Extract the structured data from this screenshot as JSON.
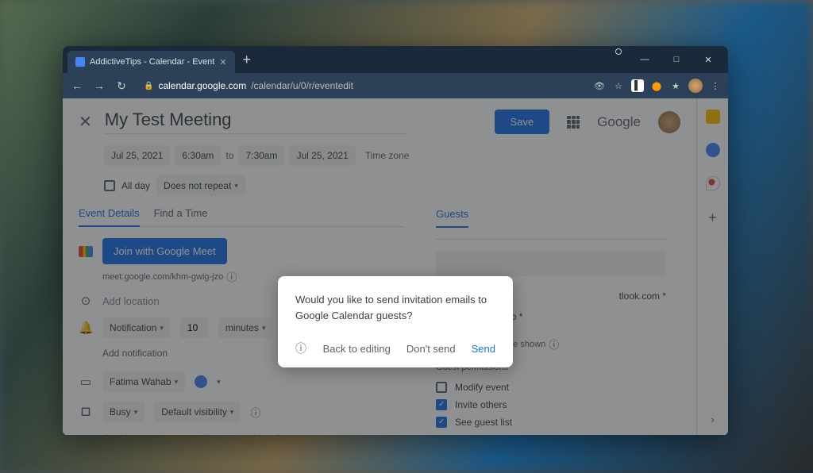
{
  "browser": {
    "tab_title": "AddictiveTips - Calendar - Event",
    "new_tab": "+",
    "url_domain": "calendar.google.com",
    "url_path": "/calendar/u/0/r/eventedit",
    "minimize": "—",
    "maximize": "□",
    "close": "✕",
    "back": "←",
    "forward": "→",
    "reload": "↻",
    "lock": "🔒",
    "eye": "👁",
    "star": "☆",
    "ext1": "▌",
    "ext2": "⬤",
    "ext3": "★",
    "menu": "⋮"
  },
  "header": {
    "close": "✕",
    "title": "My Test Meeting",
    "save": "Save",
    "google": "Google"
  },
  "datetime": {
    "start_date": "Jul 25, 2021",
    "start_time": "6:30am",
    "to": "to",
    "end_time": "7:30am",
    "end_date": "Jul 25, 2021",
    "timezone": "Time zone"
  },
  "allday": {
    "label": "All day",
    "repeat": "Does not repeat"
  },
  "tabs": {
    "details": "Event Details",
    "findtime": "Find a Time"
  },
  "meet": {
    "button": "Join with Google Meet",
    "link": "meet.google.com/khm-gwig-jzo"
  },
  "location": {
    "placeholder": "Add location"
  },
  "notification": {
    "type": "Notification",
    "value": "10",
    "unit": "minutes",
    "remove": "✕",
    "add": "Add notification"
  },
  "calendar": {
    "owner": "Fatima Wahab"
  },
  "visibility": {
    "busy": "Busy",
    "default": "Default visibility"
  },
  "guests": {
    "header": "Guests",
    "guest1_suffix": "tlook.com *",
    "guest2": "fatima wahab *",
    "note": "* Calendar cannot be shown",
    "permissions_header": "Guest permissions",
    "perm1": "Modify event",
    "perm2": "Invite others",
    "perm3": "See guest list"
  },
  "modal": {
    "text": "Would you like to send invitation emails to Google Calendar guests?",
    "help": "?",
    "back": "Back to editing",
    "dontsend": "Don't send",
    "send": "Send"
  }
}
